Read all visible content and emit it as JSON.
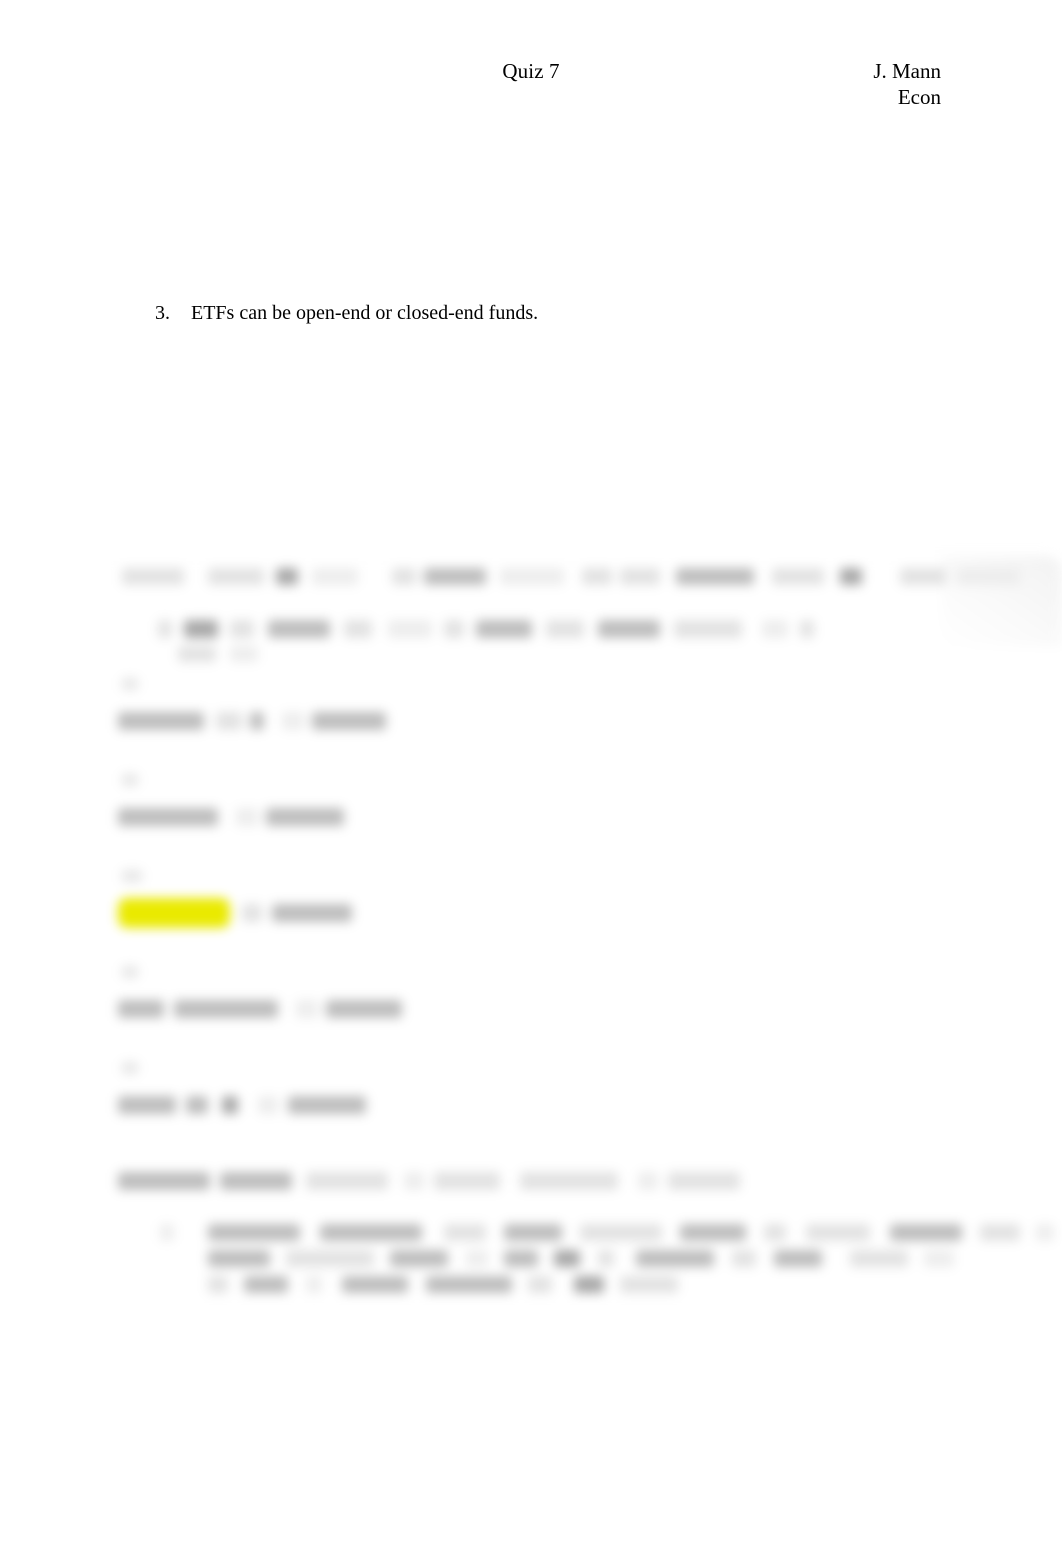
{
  "document": {
    "background_color": "#ffffff",
    "text_color": "#000000"
  },
  "header": {
    "center_title": "Quiz 7",
    "right_name": "J. Mann",
    "right_course": "Econ"
  },
  "question": {
    "number": "3.",
    "text": "ETFs can be open-end or closed-end funds."
  },
  "embedded_panel": {
    "state": "blurred",
    "description": "Redacted screenshot region with answer choices and a justified paragraph",
    "highlight_color": "#eaea00",
    "redacted_color": "#d0d0d0",
    "options": [
      {
        "id": "option-1",
        "highlighted": false
      },
      {
        "id": "option-2",
        "highlighted": false
      },
      {
        "id": "option-3",
        "highlighted": true
      },
      {
        "id": "option-4",
        "highlighted": false
      },
      {
        "id": "option-5",
        "highlighted": false
      }
    ]
  }
}
